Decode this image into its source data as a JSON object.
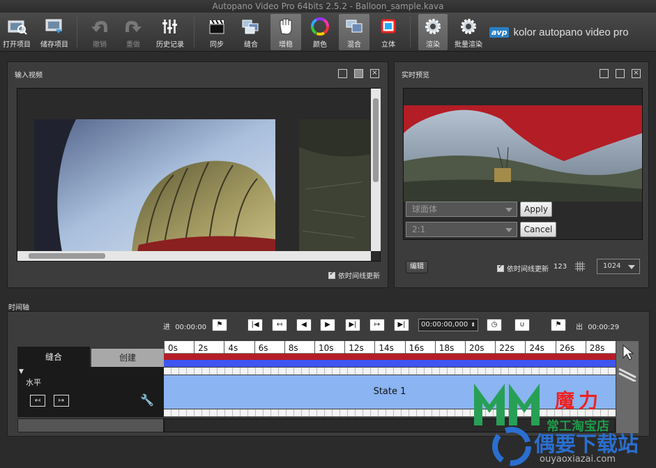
{
  "window": {
    "title": "Autopano Video Pro 64bits 2.5.2 - Balloon_sample.kava"
  },
  "toolbar": {
    "buttons": [
      {
        "label": "打开项目",
        "icon": "open-project-icon"
      },
      {
        "label": "储存项目",
        "icon": "save-project-icon"
      },
      {
        "label": "撤销",
        "icon": "undo-icon"
      },
      {
        "label": "重做",
        "icon": "redo-icon"
      },
      {
        "label": "历史记录",
        "icon": "history-icon"
      },
      {
        "label": "同步",
        "icon": "clapper-icon"
      },
      {
        "label": "缝合",
        "icon": "stitch-icon"
      },
      {
        "label": "增稳",
        "icon": "hand-icon"
      },
      {
        "label": "颜色",
        "icon": "color-wheel-icon"
      },
      {
        "label": "混合",
        "icon": "blend-icon"
      },
      {
        "label": "立体",
        "icon": "stereo-icon"
      },
      {
        "label": "渲染",
        "icon": "gear-icon"
      },
      {
        "label": "批量渲染",
        "icon": "batch-gear-icon"
      }
    ],
    "brand_badge": "avp",
    "brand_text": "kolor autopano video pro"
  },
  "input_panel": {
    "title": "输入视频",
    "realtime_update_label": "依时间线更新"
  },
  "preview_panel": {
    "title": "实时预览",
    "projection_value": "球面体",
    "ratio_value": "2:1",
    "apply_label": "Apply",
    "cancel_label": "Cancel",
    "edit_label": "编辑",
    "realtime_update_label": "依时间线更新",
    "count_label": "123",
    "resolution_value": "1024"
  },
  "timeline": {
    "title": "时间轴",
    "in_label": "进",
    "in_time": "00:00:00",
    "out_label": "出",
    "out_time": "00:00:29",
    "timecode_value": "00:00:00,000",
    "ticks": [
      "0s",
      "2s",
      "4s",
      "6s",
      "8s",
      "10s",
      "12s",
      "14s",
      "16s",
      "18s",
      "20s",
      "22s",
      "24s",
      "26s",
      "28s"
    ],
    "tab_stitch": "缝合",
    "tab_create": "创建",
    "group_label": "水平",
    "state_label": "State 1"
  },
  "watermark": {
    "logo_text": "魔力",
    "store_text": "常工淘宝店",
    "site_text": "偶要下载站",
    "url_text": "ouyaoxiazai.com"
  },
  "colors": {
    "accent_blue": "#3e55f2",
    "track_red": "#b51e27",
    "state_blue": "#8ab4f2"
  }
}
